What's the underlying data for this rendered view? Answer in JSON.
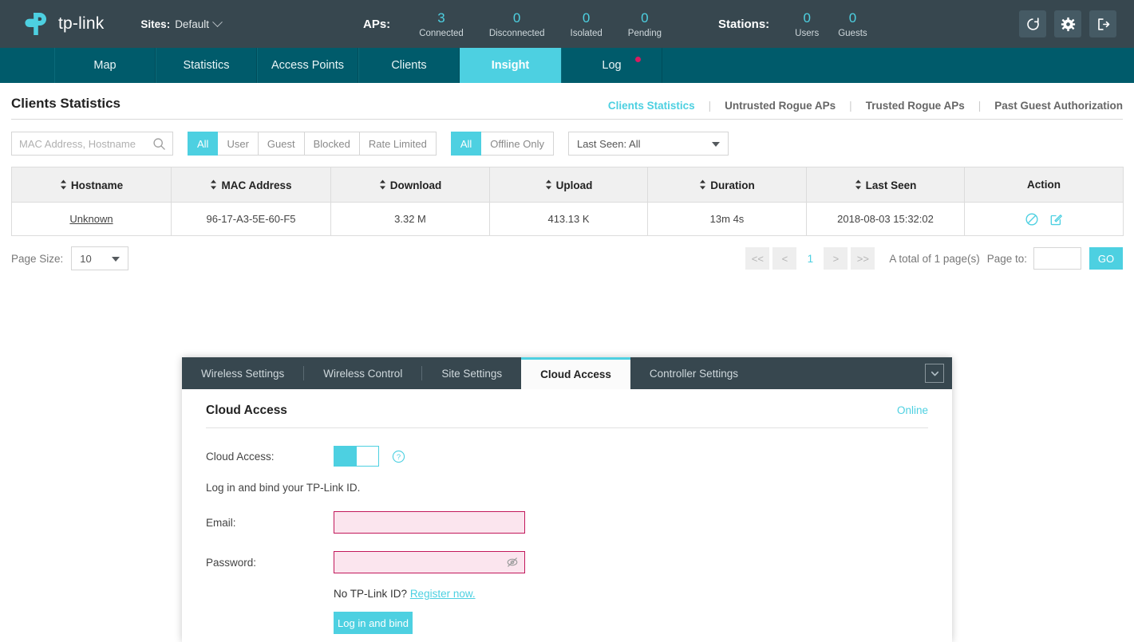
{
  "header": {
    "brand_name": "tp-link",
    "sites_label": "Sites:",
    "sites_value": "Default",
    "aps_label": "APs:",
    "stations_label": "Stations:",
    "ap_stats": [
      {
        "value": "3",
        "caption": "Connected"
      },
      {
        "value": "0",
        "caption": "Disconnected"
      },
      {
        "value": "0",
        "caption": "Isolated"
      },
      {
        "value": "0",
        "caption": "Pending"
      }
    ],
    "station_stats": [
      {
        "value": "0",
        "caption": "Users"
      },
      {
        "value": "0",
        "caption": "Guests"
      }
    ],
    "icons": [
      {
        "name": "refresh-icon"
      },
      {
        "name": "gear-icon"
      },
      {
        "name": "logout-icon"
      }
    ]
  },
  "nav": {
    "tabs": [
      {
        "label": "Map",
        "active": false,
        "dot": false
      },
      {
        "label": "Statistics",
        "active": false,
        "dot": false
      },
      {
        "label": "Access Points",
        "active": false,
        "dot": false
      },
      {
        "label": "Clients",
        "active": false,
        "dot": false
      },
      {
        "label": "Insight",
        "active": true,
        "dot": false
      },
      {
        "label": "Log",
        "active": false,
        "dot": true
      }
    ]
  },
  "page": {
    "title": "Clients Statistics",
    "subtabs": [
      {
        "label": "Clients Statistics",
        "active": true
      },
      {
        "label": "Untrusted Rogue APs",
        "active": false
      },
      {
        "label": "Trusted Rogue APs",
        "active": false
      },
      {
        "label": "Past Guest Authorization",
        "active": false
      }
    ]
  },
  "filters": {
    "search_placeholder": "MAC Address, Hostname",
    "search_value": "",
    "type_segments": [
      {
        "label": "All",
        "on": true
      },
      {
        "label": "User",
        "on": false
      },
      {
        "label": "Guest",
        "on": false
      },
      {
        "label": "Blocked",
        "on": false
      },
      {
        "label": "Rate Limited",
        "on": false
      }
    ],
    "status_segments": [
      {
        "label": "All",
        "on": true
      },
      {
        "label": "Offline Only",
        "on": false
      }
    ],
    "last_seen_select": "Last Seen: All"
  },
  "table": {
    "columns": [
      {
        "label": "Hostname",
        "sortable": true
      },
      {
        "label": "MAC Address",
        "sortable": true
      },
      {
        "label": "Download",
        "sortable": true
      },
      {
        "label": "Upload",
        "sortable": true
      },
      {
        "label": "Duration",
        "sortable": true
      },
      {
        "label": "Last Seen",
        "sortable": true
      },
      {
        "label": "Action",
        "sortable": false
      }
    ],
    "rows": [
      {
        "hostname": "Unknown",
        "mac": "96-17-A3-5E-60-F5",
        "download": "3.32 M",
        "upload": "413.13 K",
        "duration": "13m 4s",
        "last_seen": "2018-08-03 15:32:02",
        "actions": [
          "block-icon",
          "edit-icon"
        ]
      }
    ]
  },
  "pagination": {
    "page_size_label": "Page Size:",
    "page_size_value": "10",
    "first_label": "<<",
    "prev_label": "<",
    "current_page": "1",
    "next_label": ">",
    "last_label": ">>",
    "total_text": "A total of 1 page(s)",
    "page_to_label": "Page to:",
    "page_to_value": "",
    "go_label": "GO"
  },
  "settings_panel": {
    "tabs": [
      {
        "label": "Wireless Settings",
        "active": false
      },
      {
        "label": "Wireless Control",
        "active": false
      },
      {
        "label": "Site Settings",
        "active": false
      },
      {
        "label": "Cloud Access",
        "active": true
      },
      {
        "label": "Controller Settings",
        "active": false
      }
    ],
    "collapse_icon": "chevron-down-icon",
    "title": "Cloud Access",
    "status": "Online",
    "cloud_access_label": "Cloud Access:",
    "toggle_state": "on",
    "help_icon": "question-circle-icon",
    "hint": "Log in and bind your TP-Link ID.",
    "email_label": "Email:",
    "email_value": "",
    "password_label": "Password:",
    "password_value": "",
    "password_toggle_icon": "eye-off-icon",
    "register_prefix": "No TP-Link ID?",
    "register_link": "Register now.",
    "submit_label": "Log in and bind"
  },
  "colors": {
    "accent": "#4dd0e1",
    "header_bg": "#37474f",
    "nav_bg": "#005b6b",
    "error_border": "#c2185b",
    "error_bg": "#fbe5ee",
    "badge_dot": "#d81b60"
  }
}
